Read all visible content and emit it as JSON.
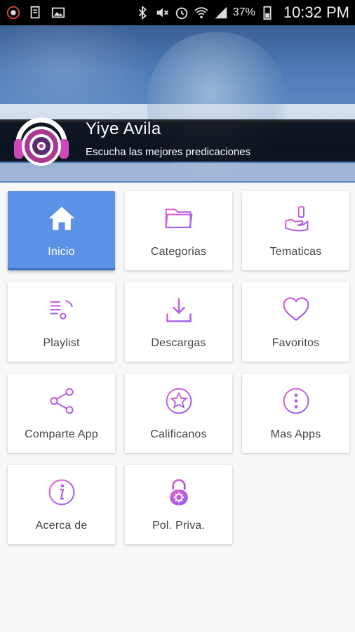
{
  "status_bar": {
    "battery_percent": "37%",
    "time": "10:32 PM"
  },
  "header": {
    "title": "Yiye Avila",
    "subtitle": "Escucha las mejores predicaciones"
  },
  "menu": [
    {
      "label": "Inicio",
      "icon": "home-icon",
      "active": true
    },
    {
      "label": "Categorias",
      "icon": "folder-icon",
      "active": false
    },
    {
      "label": "Tematicas",
      "icon": "tag-hand-icon",
      "active": false
    },
    {
      "label": "Playlist",
      "icon": "playlist-icon",
      "active": false
    },
    {
      "label": "Descargas",
      "icon": "download-icon",
      "active": false
    },
    {
      "label": "Favoritos",
      "icon": "heart-icon",
      "active": false
    },
    {
      "label": "Comparte App",
      "icon": "share-icon",
      "active": false
    },
    {
      "label": "Calificanos",
      "icon": "star-rating-icon",
      "active": false
    },
    {
      "label": "Mas Apps",
      "icon": "more-vertical-icon",
      "active": false
    },
    {
      "label": "Acerca de",
      "icon": "info-icon",
      "active": false
    },
    {
      "label": "Pol. Priva.",
      "icon": "privacy-lock-icon",
      "active": false
    }
  ],
  "colors": {
    "accent_start": "#e05cd0",
    "accent_end": "#8a5cf0",
    "active_tile": "#5c92e6"
  }
}
